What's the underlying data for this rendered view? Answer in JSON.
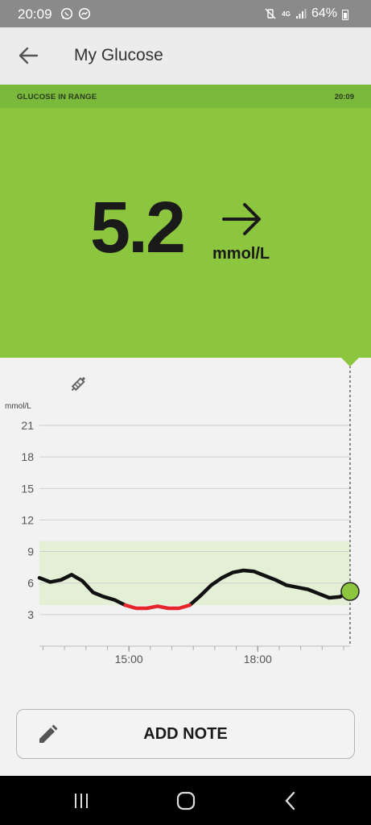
{
  "status_bar": {
    "time": "20:09",
    "left_icons": [
      "whatsapp-icon",
      "messenger-icon"
    ],
    "network": "4G",
    "battery": "64%"
  },
  "app_bar": {
    "title": "My Glucose"
  },
  "range_strip": {
    "label": "GLUCOSE IN RANGE",
    "time": "20:09"
  },
  "reading": {
    "value": "5.2",
    "unit": "mmol/L",
    "trend": "steady"
  },
  "colors": {
    "panel_green": "#8cc63f",
    "strip_green": "#7ab93c",
    "target_band": "#e3f0d6",
    "low_segment": "#e5262c",
    "current_point": "#8cc63f"
  },
  "chart_data": {
    "type": "line",
    "ylabel": "mmol/L",
    "yticks": [
      3,
      6,
      9,
      12,
      15,
      18,
      21
    ],
    "ylim": [
      0,
      21
    ],
    "xticks": [
      "15:00",
      "18:00"
    ],
    "x_start": "12:55",
    "x_end": "20:09",
    "target_range": [
      3.9,
      10.0
    ],
    "grid": "horizontal",
    "insulin_marker_time": "13:50",
    "series": [
      {
        "points": [
          [
            "12:55",
            6.5
          ],
          [
            "13:10",
            6.1
          ],
          [
            "13:25",
            6.3
          ],
          [
            "13:40",
            6.8
          ],
          [
            "13:55",
            6.2
          ],
          [
            "14:10",
            5.1
          ],
          [
            "14:25",
            4.7
          ],
          [
            "14:40",
            4.4
          ],
          [
            "14:55",
            3.9
          ],
          [
            "15:10",
            3.6
          ],
          [
            "15:25",
            3.6
          ],
          [
            "15:40",
            3.8
          ],
          [
            "15:55",
            3.6
          ],
          [
            "16:10",
            3.6
          ],
          [
            "16:25",
            3.9
          ],
          [
            "16:40",
            4.8
          ],
          [
            "16:55",
            5.8
          ],
          [
            "17:10",
            6.5
          ],
          [
            "17:25",
            7.0
          ],
          [
            "17:40",
            7.2
          ],
          [
            "17:55",
            7.1
          ],
          [
            "18:10",
            6.7
          ],
          [
            "18:25",
            6.3
          ],
          [
            "18:40",
            5.8
          ],
          [
            "18:55",
            5.6
          ],
          [
            "19:10",
            5.4
          ],
          [
            "19:25",
            5.0
          ],
          [
            "19:40",
            4.6
          ],
          [
            "19:55",
            4.7
          ],
          [
            "20:09",
            5.2
          ]
        ]
      }
    ],
    "low_range": [
      "14:55",
      "16:25"
    ],
    "current_time": "20:09"
  },
  "add_note": {
    "label": "ADD NOTE"
  },
  "nav_bar": {
    "buttons": [
      "recent-apps-icon",
      "home-icon",
      "back-icon"
    ]
  }
}
